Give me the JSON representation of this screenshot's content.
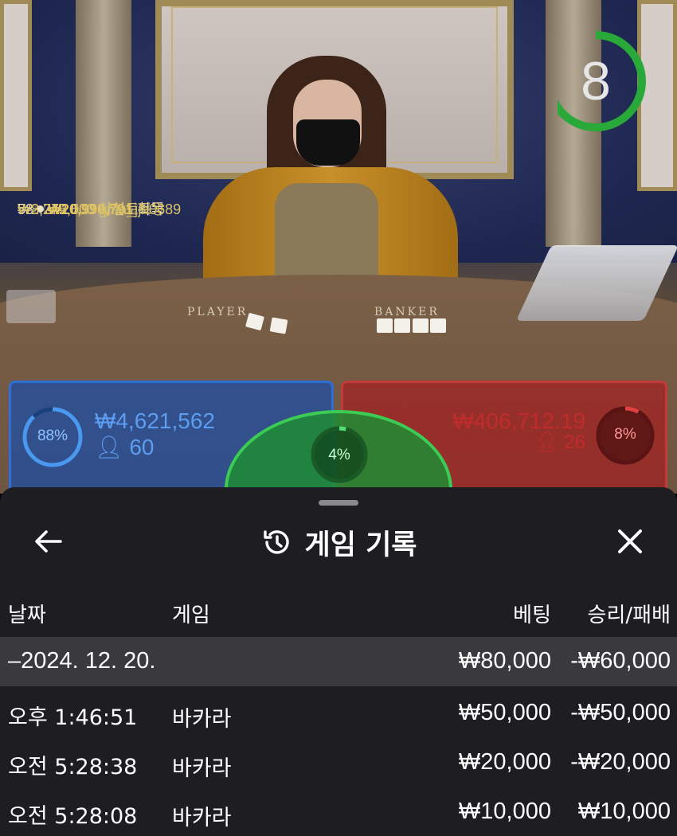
{
  "live": {
    "timer": "8",
    "timer_fraction": 0.7,
    "table_labels": {
      "player": "PLAYER",
      "banker": "BANKER"
    },
    "winners": {
      "count": "58",
      "total": "₩20,990,791",
      "suffix": "획득",
      "list": [
        {
          "amount": "₩8,775,000",
          "name": "gma_jjh0689"
        },
        {
          "amount": "₩2,242,500",
          "name": "사설토토왕"
        },
        {
          "amount": "₩1,069,500",
          "name": "청각상어"
        }
      ]
    },
    "player_spot": {
      "percent": "88%",
      "percent_value": 0.88,
      "amount": "₩4,621,562",
      "players": "60",
      "color": "#2c6fd6"
    },
    "tie_spot": {
      "percent": "4%",
      "percent_value": 0.04,
      "color": "#3ccc55"
    },
    "banker_spot": {
      "percent": "8%",
      "percent_value": 0.08,
      "amount": "₩406,712.19",
      "players": "26",
      "color": "#c43a3a"
    }
  },
  "sheet": {
    "title": "게임 기록",
    "icons": {
      "back": "arrow-left-icon",
      "history": "history-icon",
      "close": "close-icon"
    },
    "columns": {
      "date": "날짜",
      "game": "게임",
      "bet": "베팅",
      "result": "승리/패배"
    },
    "group": {
      "label": "–2024. 12. 20.",
      "bet": "₩80,000",
      "result": "-₩60,000"
    },
    "rows": [
      {
        "time": "오후 1:46:51",
        "game": "바카라",
        "bet": "₩50,000",
        "result": "-₩50,000"
      },
      {
        "time": "오전 5:28:38",
        "game": "바카라",
        "bet": "₩20,000",
        "result": "-₩20,000"
      },
      {
        "time": "오전 5:28:08",
        "game": "바카라",
        "bet": "₩10,000",
        "result": "₩10,000"
      }
    ]
  }
}
